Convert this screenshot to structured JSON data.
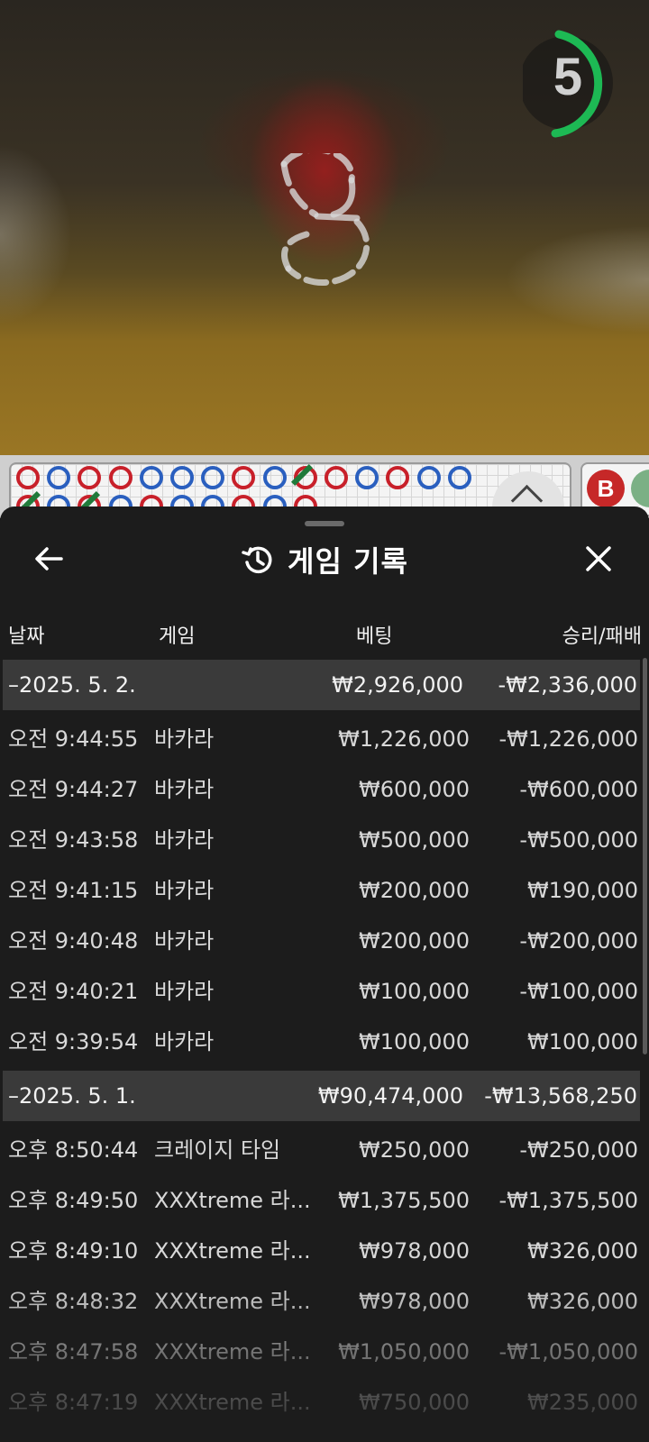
{
  "video": {
    "countdown": "5",
    "timer_color": "#1db954"
  },
  "roadmap": {
    "beads_top": [
      "r",
      "b",
      "r",
      "r",
      "b",
      "b",
      "b",
      "r",
      "b",
      "r",
      "r",
      "b",
      "r",
      "b",
      "b"
    ],
    "beads_bottom": [
      "r",
      "b",
      "r",
      "b",
      "r",
      "b",
      "b",
      "r",
      "b",
      "r"
    ],
    "side_button": "B"
  },
  "history": {
    "title": "게임 기록",
    "columns": {
      "date": "날짜",
      "game": "게임",
      "bet": "베팅",
      "result": "승리/패배"
    },
    "groups": [
      {
        "date": "–2025. 5. 2.",
        "bet": "₩2,926,000",
        "result": "-₩2,336,000",
        "rows": [
          {
            "time": "오전 9:44:55",
            "game": "바카라",
            "bet": "₩1,226,000",
            "result": "-₩1,226,000"
          },
          {
            "time": "오전 9:44:27",
            "game": "바카라",
            "bet": "₩600,000",
            "result": "-₩600,000"
          },
          {
            "time": "오전 9:43:58",
            "game": "바카라",
            "bet": "₩500,000",
            "result": "-₩500,000"
          },
          {
            "time": "오전 9:41:15",
            "game": "바카라",
            "bet": "₩200,000",
            "result": "₩190,000"
          },
          {
            "time": "오전 9:40:48",
            "game": "바카라",
            "bet": "₩200,000",
            "result": "-₩200,000"
          },
          {
            "time": "오전 9:40:21",
            "game": "바카라",
            "bet": "₩100,000",
            "result": "-₩100,000"
          },
          {
            "time": "오전 9:39:54",
            "game": "바카라",
            "bet": "₩100,000",
            "result": "₩100,000"
          }
        ]
      },
      {
        "date": "–2025. 5. 1.",
        "bet": "₩90,474,000",
        "result": "-₩13,568,250",
        "rows": [
          {
            "time": "오후 8:50:44",
            "game": "크레이지 타임",
            "bet": "₩250,000",
            "result": "-₩250,000"
          },
          {
            "time": "오후 8:49:50",
            "game": "XXXtreme 라...",
            "bet": "₩1,375,500",
            "result": "-₩1,375,500"
          },
          {
            "time": "오후 8:49:10",
            "game": "XXXtreme 라...",
            "bet": "₩978,000",
            "result": "₩326,000"
          },
          {
            "time": "오후 8:48:32",
            "game": "XXXtreme 라...",
            "bet": "₩978,000",
            "result": "₩326,000"
          },
          {
            "time": "오후 8:47:58",
            "game": "XXXtreme 라...",
            "bet": "₩1,050,000",
            "result": "-₩1,050,000"
          },
          {
            "time": "오후 8:47:19",
            "game": "XXXtreme 라...",
            "bet": "₩750,000",
            "result": "₩235,000"
          }
        ]
      }
    ]
  }
}
